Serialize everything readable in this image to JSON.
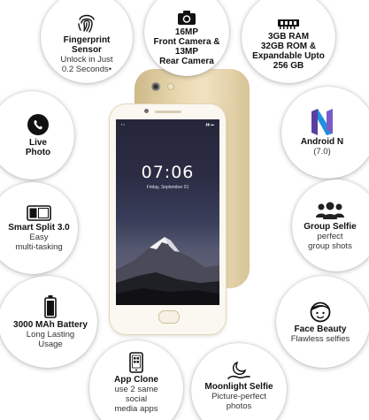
{
  "features": {
    "fingerprint": {
      "title": "Fingerprint\nSensor",
      "sub": "Unlock in Just\n0.2 Seconds•",
      "icon": "fingerprint-icon"
    },
    "camera": {
      "title": "16MP\nFront Camera &\n13MP\nRear Camera",
      "icon": "camera-icon"
    },
    "memory": {
      "title": "3GB RAM\n32GB ROM &\nExpandable Upto\n256 GB",
      "icon": "memory-chip-icon"
    },
    "live_photo": {
      "title": "Live\nPhoto",
      "icon": "live-photo-icon"
    },
    "android": {
      "title": "Android N",
      "sub": "(7.0)",
      "icon": "android-n-icon"
    },
    "smart_split": {
      "title": "Smart Split 3.0",
      "sub": "Easy\nmulti-tasking",
      "icon": "split-screen-icon"
    },
    "group_selfie": {
      "title": "Group Selfie",
      "sub": "perfect\ngroup shots",
      "icon": "group-icon"
    },
    "battery": {
      "title": "3000 MAh Battery",
      "sub": "Long Lasting\nUsage",
      "icon": "battery-icon"
    },
    "face_beauty": {
      "title": "Face Beauty",
      "sub": "Flawless selfies",
      "icon": "face-icon"
    },
    "app_clone": {
      "title": "App Clone",
      "sub": "use 2 same\nsocial\nmedia apps",
      "icon": "app-clone-icon"
    },
    "moonlight": {
      "title": "Moonlight Selfie",
      "sub": "Picture-perfect\nphotos",
      "icon": "moonlight-icon"
    }
  },
  "phone": {
    "time": "07:06",
    "date": "Friday, September 01"
  },
  "colors": {
    "gold": "#e6d4a8",
    "android_purple": "#5a3fa0",
    "android_blue": "#1f8fe0"
  }
}
